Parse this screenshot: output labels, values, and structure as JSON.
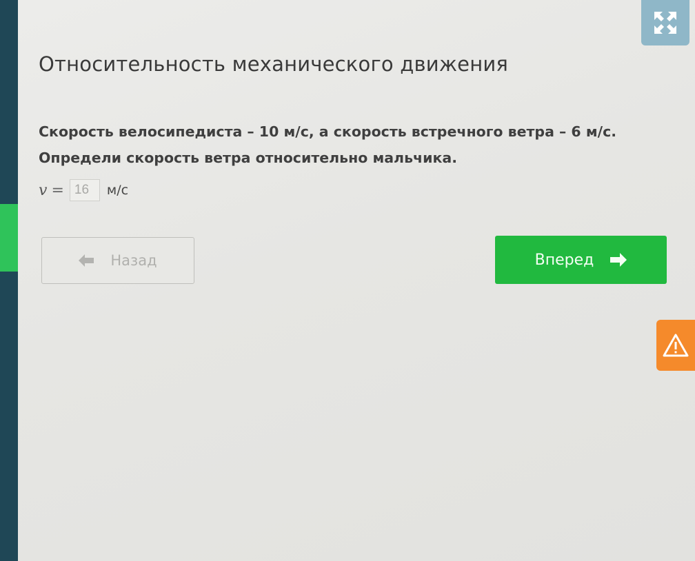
{
  "lesson": {
    "title": "Относительность механического движения"
  },
  "task": {
    "line1": "Скорость велосипедиста – 10 м/с, а скорость встречного ветра – 6 м/с.",
    "line2": "Определи скорость ветра относительно мальчика."
  },
  "answer": {
    "variable": "v",
    "equals": "=",
    "value": "16",
    "unit": "м/с"
  },
  "nav": {
    "back_label": "Назад",
    "next_label": "Вперед"
  },
  "icons": {
    "expand": "expand-icon",
    "back_arrow": "arrow-left-icon",
    "next_arrow": "arrow-right-icon",
    "warning": "warning-icon"
  },
  "colors": {
    "rail": "#1f4756",
    "accent_green": "#21b93f",
    "expand_button": "#8fb7c8",
    "warning_button": "#f58a2b"
  }
}
